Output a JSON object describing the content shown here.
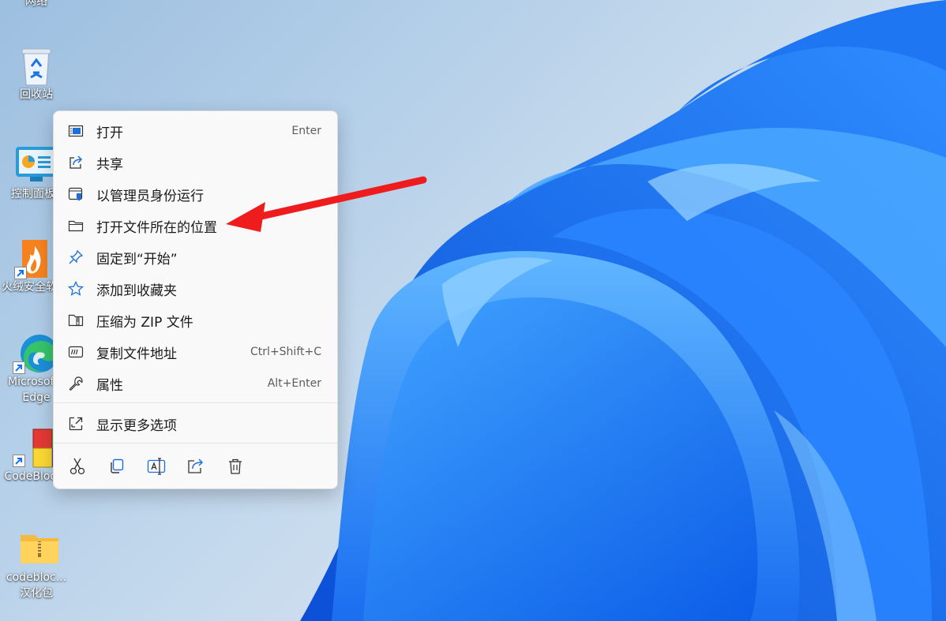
{
  "desktop": {
    "icons": [
      {
        "label": "网络",
        "label2": ""
      },
      {
        "label": "回收站",
        "label2": ""
      },
      {
        "label": "控制面板",
        "label2": ""
      },
      {
        "label": "火绒安全软件",
        "label2": ""
      },
      {
        "label": "Microsoft",
        "label2": "Edge"
      },
      {
        "label": "CodeBlocks",
        "label2": ""
      },
      {
        "label": "codebloc...",
        "label2": "汉化包"
      }
    ]
  },
  "context_menu": {
    "items": [
      {
        "label": "打开",
        "shortcut": "Enter",
        "icon": "open-icon"
      },
      {
        "label": "共享",
        "shortcut": "",
        "icon": "share-icon"
      },
      {
        "label": "以管理员身份运行",
        "shortcut": "",
        "icon": "admin-shield-icon"
      },
      {
        "label": "打开文件所在的位置",
        "shortcut": "",
        "icon": "folder-icon"
      },
      {
        "label": "固定到“开始”",
        "shortcut": "",
        "icon": "pin-icon"
      },
      {
        "label": "添加到收藏夹",
        "shortcut": "",
        "icon": "star-icon"
      },
      {
        "label": "压缩为 ZIP 文件",
        "shortcut": "",
        "icon": "zip-folder-icon"
      },
      {
        "label": "复制文件地址",
        "shortcut": "Ctrl+Shift+C",
        "icon": "copy-path-icon"
      },
      {
        "label": "属性",
        "shortcut": "Alt+Enter",
        "icon": "wrench-icon"
      }
    ],
    "more": {
      "label": "显示更多选项",
      "icon": "show-more-icon"
    },
    "toolbar": [
      "cut-icon",
      "copy-icon",
      "rename-icon",
      "share-icon",
      "delete-icon"
    ]
  },
  "colors": {
    "accent": "#0067c0",
    "arrow": "#ee1c1c"
  }
}
